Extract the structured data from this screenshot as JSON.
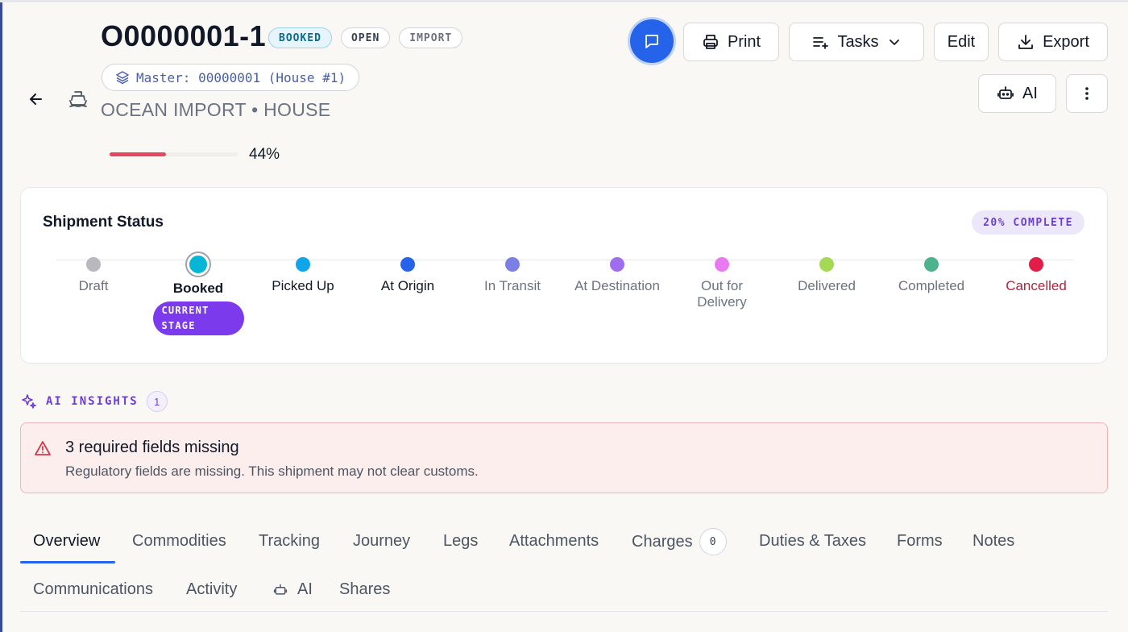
{
  "header": {
    "title": "O0000001-1",
    "badges": [
      "BOOKED",
      "OPEN",
      "IMPORT"
    ],
    "master_label": "Master: 00000001 (House #1)",
    "subtitle": "OCEAN IMPORT • HOUSE",
    "progress_percent": 44,
    "progress_label": "44%",
    "progress_color": "#e8455f"
  },
  "toolbar": {
    "print_label": "Print",
    "tasks_label": "Tasks",
    "edit_label": "Edit",
    "export_label": "Export",
    "ai_label": "AI"
  },
  "status": {
    "title": "Shipment Status",
    "complete_label": "20% COMPLETE",
    "current_tag": "CURRENT STAGE",
    "stages": [
      {
        "label": "Draft",
        "color": "#b8b9bd"
      },
      {
        "label": "Booked",
        "color": "#06b6d4"
      },
      {
        "label": "Picked Up",
        "color": "#0ea5e9"
      },
      {
        "label": "At Origin",
        "color": "#2563eb"
      },
      {
        "label": "In Transit",
        "color": "#7b7fe6"
      },
      {
        "label": "At Destination",
        "color": "#9f6ef0"
      },
      {
        "label": "Out for Delivery",
        "color": "#e879f0"
      },
      {
        "label": "Delivered",
        "color": "#a3d955"
      },
      {
        "label": "Completed",
        "color": "#4db38f"
      },
      {
        "label": "Cancelled",
        "color": "#e11d48"
      }
    ]
  },
  "insights": {
    "label": "AI INSIGHTS",
    "count": "1",
    "alert_title": "3 required fields missing",
    "alert_text": "Regulatory fields are missing. This shipment may not clear customs."
  },
  "tabs": {
    "overview": "Overview",
    "commodities": "Commodities",
    "tracking": "Tracking",
    "journey": "Journey",
    "legs": "Legs",
    "attachments": "Attachments",
    "charges": "Charges",
    "charges_count": "0",
    "duties": "Duties & Taxes",
    "forms": "Forms",
    "notes": "Notes",
    "communications": "Communications",
    "activity": "Activity",
    "ai": "AI",
    "shares": "Shares"
  }
}
